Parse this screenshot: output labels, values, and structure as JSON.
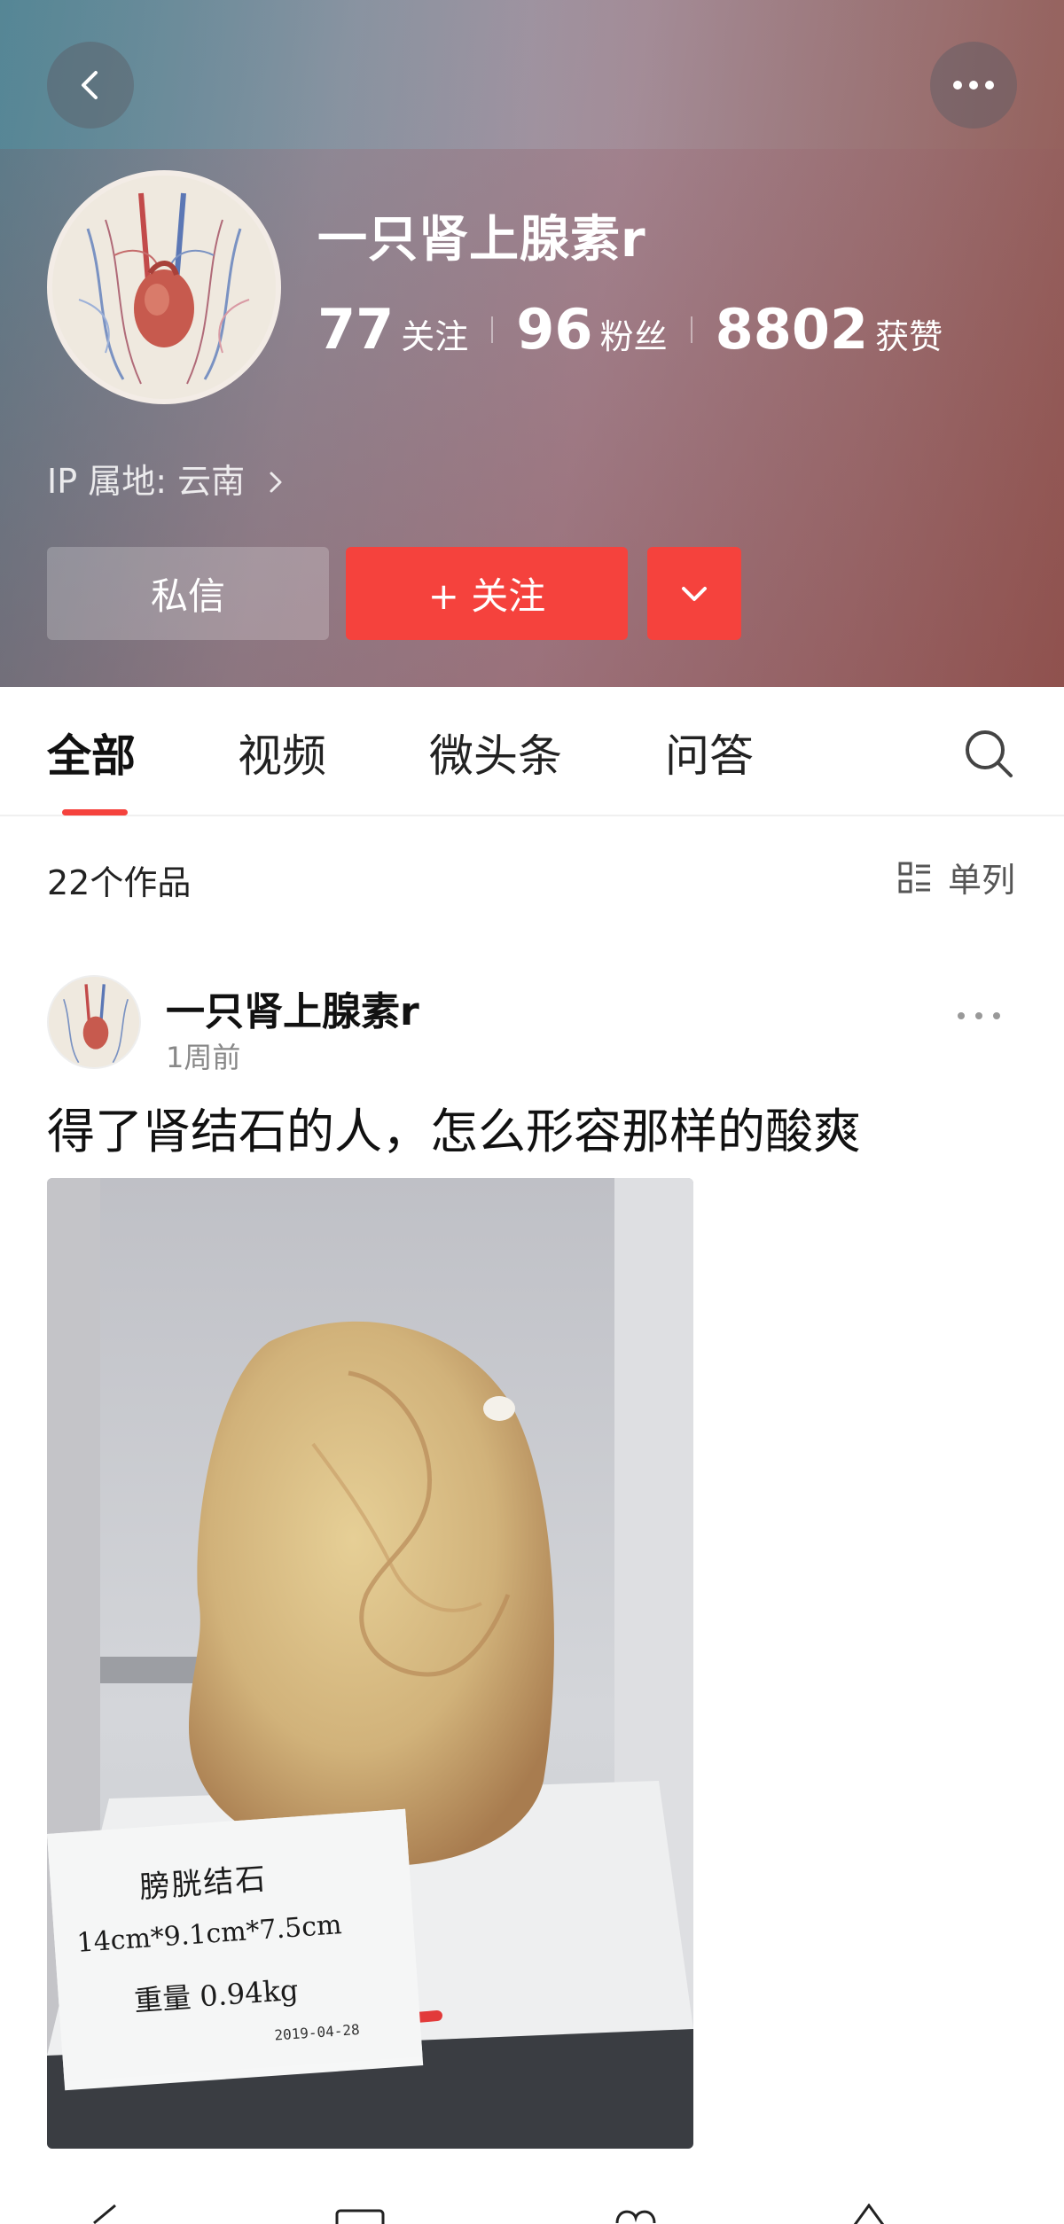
{
  "profile": {
    "name": "一只肾上腺素r",
    "stats": [
      {
        "value": "77",
        "label": "关注"
      },
      {
        "value": "96",
        "label": "粉丝"
      },
      {
        "value": "8802",
        "label": "获赞"
      }
    ],
    "ip": "IP 属地: 云南",
    "buttons": {
      "message": "私信",
      "follow": "+ 关注"
    }
  },
  "tabs": [
    "全部",
    "视频",
    "微头条",
    "问答"
  ],
  "list": {
    "count": "22个作品",
    "layout_label": "单列"
  },
  "post": {
    "author": "一只肾上腺素r",
    "time": "1周前",
    "text": "得了肾结石的人，怎么形容那样的酸爽",
    "image_label": {
      "title": "膀胱结石",
      "size": "14cm*9.1cm*7.5cm",
      "weight": "重量 0.94kg",
      "date": "2019-04-28"
    }
  },
  "colors": {
    "accent": "#f5423d",
    "follow_button": "#f5423d"
  },
  "icons": [
    "back-arrow-icon",
    "more-icon",
    "chevron-right-icon",
    "chevron-down-icon",
    "search-icon",
    "list-layout-icon"
  ]
}
